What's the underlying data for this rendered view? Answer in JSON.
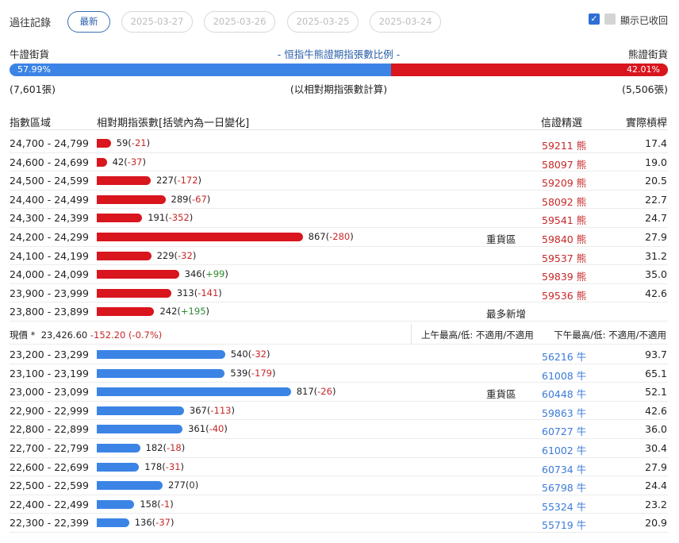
{
  "header": {
    "title": "過往記錄",
    "tabs": [
      {
        "label": "最新",
        "active": true
      },
      {
        "label": "2025-03-27",
        "active": false
      },
      {
        "label": "2025-03-26",
        "active": false
      },
      {
        "label": "2025-03-25",
        "active": false
      },
      {
        "label": "2025-03-24",
        "active": false
      }
    ],
    "show_recalled_label": "顯示已收回"
  },
  "ratio": {
    "bull_label": "牛證街貨",
    "title": "- 恒指牛熊證期指張數比例 -",
    "bear_label": "熊證街貨",
    "bull_pct": 57.99,
    "bull_pct_text": "57.99%",
    "bear_pct_text": "42.01%",
    "bull_count": "(7,601張)",
    "note": "(以相對期指張數計算)",
    "bear_count": "(5,506張)"
  },
  "table": {
    "headers": {
      "range": "指數區域",
      "contracts": "相對期指張數[括號內為一日變化]",
      "warrant": "信證精選",
      "leverage": "實際槓桿"
    },
    "bear_rows": [
      {
        "range": "24,700 - 24,799",
        "value": 59,
        "change": "-21",
        "tag": "",
        "code": "59211 熊",
        "leverage": "17.4"
      },
      {
        "range": "24,600 - 24,699",
        "value": 42,
        "change": "-37",
        "tag": "",
        "code": "58097 熊",
        "leverage": "19.0"
      },
      {
        "range": "24,500 - 24,599",
        "value": 227,
        "change": "-172",
        "tag": "",
        "code": "59209 熊",
        "leverage": "20.5"
      },
      {
        "range": "24,400 - 24,499",
        "value": 289,
        "change": "-67",
        "tag": "",
        "code": "58092 熊",
        "leverage": "22.7"
      },
      {
        "range": "24,300 - 24,399",
        "value": 191,
        "change": "-352",
        "tag": "",
        "code": "59541 熊",
        "leverage": "24.7"
      },
      {
        "range": "24,200 - 24,299",
        "value": 867,
        "change": "-280",
        "tag": "重貨區",
        "code": "59840 熊",
        "leverage": "27.9"
      },
      {
        "range": "24,100 - 24,199",
        "value": 229,
        "change": "-32",
        "tag": "",
        "code": "59537 熊",
        "leverage": "31.2"
      },
      {
        "range": "24,000 - 24,099",
        "value": 346,
        "change": "+99",
        "tag": "",
        "code": "59839 熊",
        "leverage": "35.0"
      },
      {
        "range": "23,900 - 23,999",
        "value": 313,
        "change": "-141",
        "tag": "",
        "code": "59536 熊",
        "leverage": "42.6"
      },
      {
        "range": "23,800 - 23,899",
        "value": 242,
        "change": "+195",
        "tag": "最多新增",
        "code": "",
        "leverage": ""
      }
    ],
    "current": {
      "label": "現價 *",
      "price": "23,426.60",
      "change": "-152.20 (-0.7%)",
      "am": "上午最高/低: 不適用/不適用",
      "pm": "下午最高/低: 不適用/不適用"
    },
    "bull_rows": [
      {
        "range": "23,200 - 23,299",
        "value": 540,
        "change": "-32",
        "tag": "",
        "code": "56216 牛",
        "leverage": "93.7"
      },
      {
        "range": "23,100 - 23,199",
        "value": 539,
        "change": "-179",
        "tag": "",
        "code": "61008 牛",
        "leverage": "65.1"
      },
      {
        "range": "23,000 - 23,099",
        "value": 817,
        "change": "-26",
        "tag": "重貨區",
        "code": "60448 牛",
        "leverage": "52.1"
      },
      {
        "range": "22,900 - 22,999",
        "value": 367,
        "change": "-113",
        "tag": "",
        "code": "59863 牛",
        "leverage": "42.6"
      },
      {
        "range": "22,800 - 22,899",
        "value": 361,
        "change": "-40",
        "tag": "",
        "code": "60727 牛",
        "leverage": "36.0"
      },
      {
        "range": "22,700 - 22,799",
        "value": 182,
        "change": "-18",
        "tag": "",
        "code": "61002 牛",
        "leverage": "30.4"
      },
      {
        "range": "22,600 - 22,699",
        "value": 178,
        "change": "-31",
        "tag": "",
        "code": "60734 牛",
        "leverage": "27.9"
      },
      {
        "range": "22,500 - 22,599",
        "value": 277,
        "change": "0",
        "tag": "",
        "code": "56798 牛",
        "leverage": "24.4"
      },
      {
        "range": "22,400 - 22,499",
        "value": 158,
        "change": "-1",
        "tag": "",
        "code": "55324 牛",
        "leverage": "23.2"
      },
      {
        "range": "22,300 - 22,399",
        "value": 136,
        "change": "-37",
        "tag": "",
        "code": "55719 牛",
        "leverage": "20.9"
      }
    ]
  },
  "colors": {
    "bull": "#3b84e6",
    "bear": "#d9151d",
    "accent": "#2b5ea8"
  }
}
